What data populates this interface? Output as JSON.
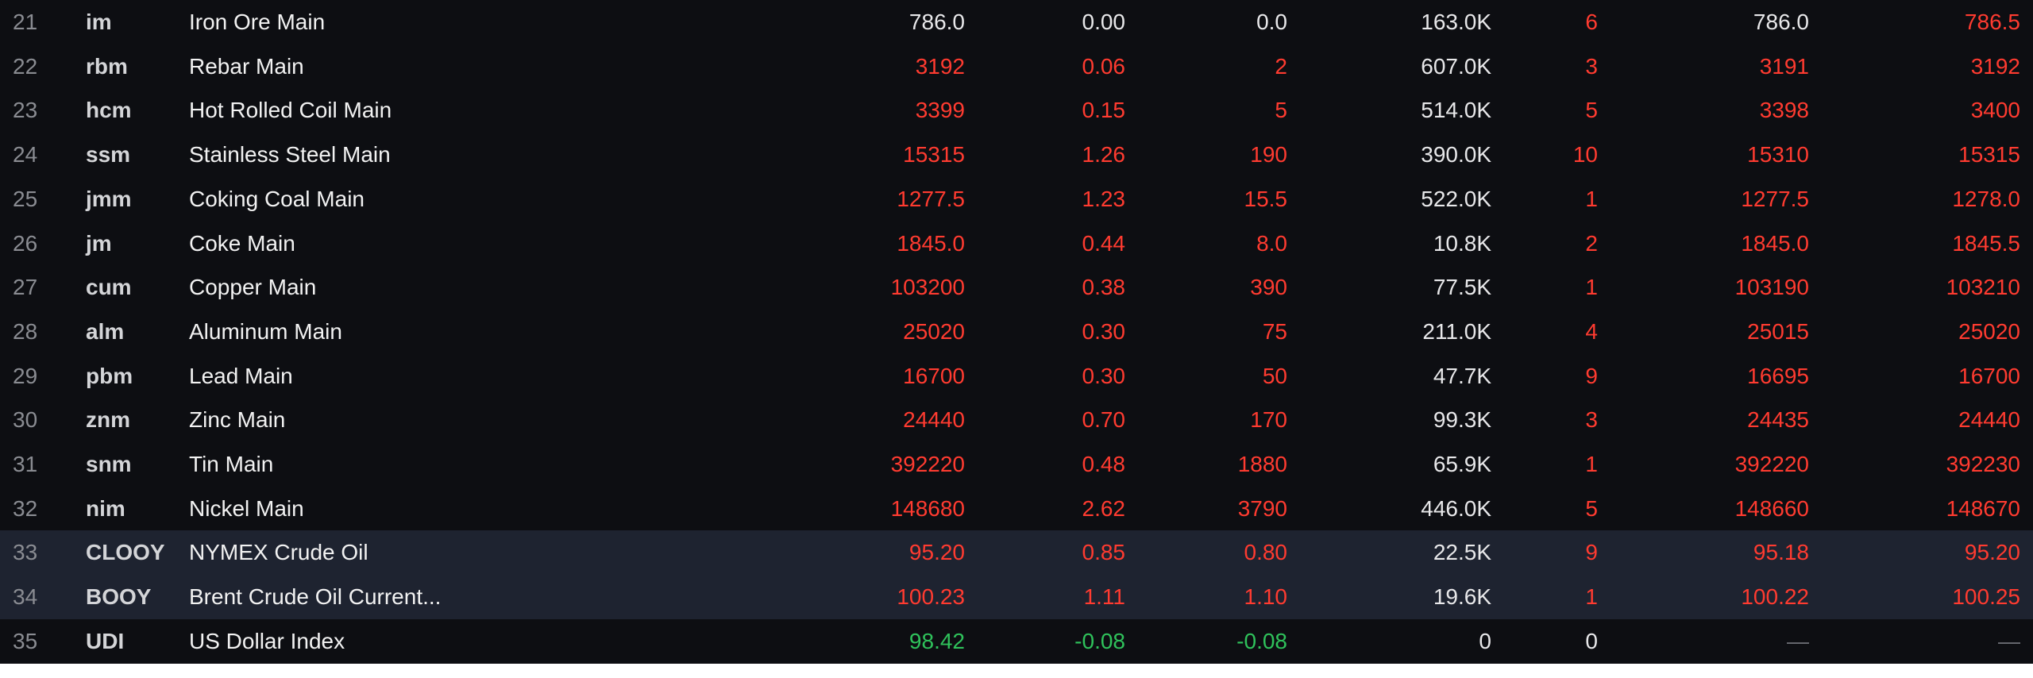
{
  "colors": {
    "up": "#ff3b30",
    "down": "#2fc25b",
    "flat": "#e8e8ea",
    "row_highlight": "#1e2330",
    "background": "#0d0e12"
  },
  "rows": [
    {
      "num": "21",
      "code": "im",
      "name": "Iron Ore Main",
      "price": "786.0",
      "pct": "0.00",
      "chg": "0.0",
      "vol": "163.0K",
      "cnt": "6",
      "bid": "786.0",
      "ask": "786.5",
      "c": [
        "flat",
        "flat",
        "flat",
        "up",
        "flat",
        "up"
      ],
      "hl": false
    },
    {
      "num": "22",
      "code": "rbm",
      "name": "Rebar Main",
      "price": "3192",
      "pct": "0.06",
      "chg": "2",
      "vol": "607.0K",
      "cnt": "3",
      "bid": "3191",
      "ask": "3192",
      "c": [
        "up",
        "up",
        "up",
        "up",
        "up",
        "up"
      ],
      "hl": false
    },
    {
      "num": "23",
      "code": "hcm",
      "name": "Hot Rolled Coil Main",
      "price": "3399",
      "pct": "0.15",
      "chg": "5",
      "vol": "514.0K",
      "cnt": "5",
      "bid": "3398",
      "ask": "3400",
      "c": [
        "up",
        "up",
        "up",
        "up",
        "up",
        "up"
      ],
      "hl": false
    },
    {
      "num": "24",
      "code": "ssm",
      "name": "Stainless Steel Main",
      "price": "15315",
      "pct": "1.26",
      "chg": "190",
      "vol": "390.0K",
      "cnt": "10",
      "bid": "15310",
      "ask": "15315",
      "c": [
        "up",
        "up",
        "up",
        "up",
        "up",
        "up"
      ],
      "hl": false
    },
    {
      "num": "25",
      "code": "jmm",
      "name": "Coking Coal Main",
      "price": "1277.5",
      "pct": "1.23",
      "chg": "15.5",
      "vol": "522.0K",
      "cnt": "1",
      "bid": "1277.5",
      "ask": "1278.0",
      "c": [
        "up",
        "up",
        "up",
        "up",
        "up",
        "up"
      ],
      "hl": false
    },
    {
      "num": "26",
      "code": "jm",
      "name": "Coke Main",
      "price": "1845.0",
      "pct": "0.44",
      "chg": "8.0",
      "vol": "10.8K",
      "cnt": "2",
      "bid": "1845.0",
      "ask": "1845.5",
      "c": [
        "up",
        "up",
        "up",
        "up",
        "up",
        "up"
      ],
      "hl": false
    },
    {
      "num": "27",
      "code": "cum",
      "name": "Copper Main",
      "price": "103200",
      "pct": "0.38",
      "chg": "390",
      "vol": "77.5K",
      "cnt": "1",
      "bid": "103190",
      "ask": "103210",
      "c": [
        "up",
        "up",
        "up",
        "up",
        "up",
        "up"
      ],
      "hl": false
    },
    {
      "num": "28",
      "code": "alm",
      "name": "Aluminum Main",
      "price": "25020",
      "pct": "0.30",
      "chg": "75",
      "vol": "211.0K",
      "cnt": "4",
      "bid": "25015",
      "ask": "25020",
      "c": [
        "up",
        "up",
        "up",
        "up",
        "up",
        "up"
      ],
      "hl": false
    },
    {
      "num": "29",
      "code": "pbm",
      "name": "Lead Main",
      "price": "16700",
      "pct": "0.30",
      "chg": "50",
      "vol": "47.7K",
      "cnt": "9",
      "bid": "16695",
      "ask": "16700",
      "c": [
        "up",
        "up",
        "up",
        "up",
        "up",
        "up"
      ],
      "hl": false
    },
    {
      "num": "30",
      "code": "znm",
      "name": "Zinc Main",
      "price": "24440",
      "pct": "0.70",
      "chg": "170",
      "vol": "99.3K",
      "cnt": "3",
      "bid": "24435",
      "ask": "24440",
      "c": [
        "up",
        "up",
        "up",
        "up",
        "up",
        "up"
      ],
      "hl": false
    },
    {
      "num": "31",
      "code": "snm",
      "name": "Tin Main",
      "price": "392220",
      "pct": "0.48",
      "chg": "1880",
      "vol": "65.9K",
      "cnt": "1",
      "bid": "392220",
      "ask": "392230",
      "c": [
        "up",
        "up",
        "up",
        "up",
        "up",
        "up"
      ],
      "hl": false
    },
    {
      "num": "32",
      "code": "nim",
      "name": "Nickel Main",
      "price": "148680",
      "pct": "2.62",
      "chg": "3790",
      "vol": "446.0K",
      "cnt": "5",
      "bid": "148660",
      "ask": "148670",
      "c": [
        "up",
        "up",
        "up",
        "up",
        "up",
        "up"
      ],
      "hl": false
    },
    {
      "num": "33",
      "code": "CLOOY",
      "name": "NYMEX Crude Oil",
      "price": "95.20",
      "pct": "0.85",
      "chg": "0.80",
      "vol": "22.5K",
      "cnt": "9",
      "bid": "95.18",
      "ask": "95.20",
      "c": [
        "up",
        "up",
        "up",
        "up",
        "up",
        "up"
      ],
      "hl": true
    },
    {
      "num": "34",
      "code": "BOOY",
      "name": "Brent Crude Oil Current...",
      "price": "100.23",
      "pct": "1.11",
      "chg": "1.10",
      "vol": "19.6K",
      "cnt": "1",
      "bid": "100.22",
      "ask": "100.25",
      "c": [
        "up",
        "up",
        "up",
        "up",
        "up",
        "up"
      ],
      "hl": true
    },
    {
      "num": "35",
      "code": "UDI",
      "name": "US Dollar Index",
      "price": "98.42",
      "pct": "-0.08",
      "chg": "-0.08",
      "vol": "0",
      "cnt": "0",
      "bid": "—",
      "ask": "—",
      "c": [
        "down",
        "down",
        "down",
        "flat",
        "na",
        "na"
      ],
      "hl": false
    }
  ]
}
